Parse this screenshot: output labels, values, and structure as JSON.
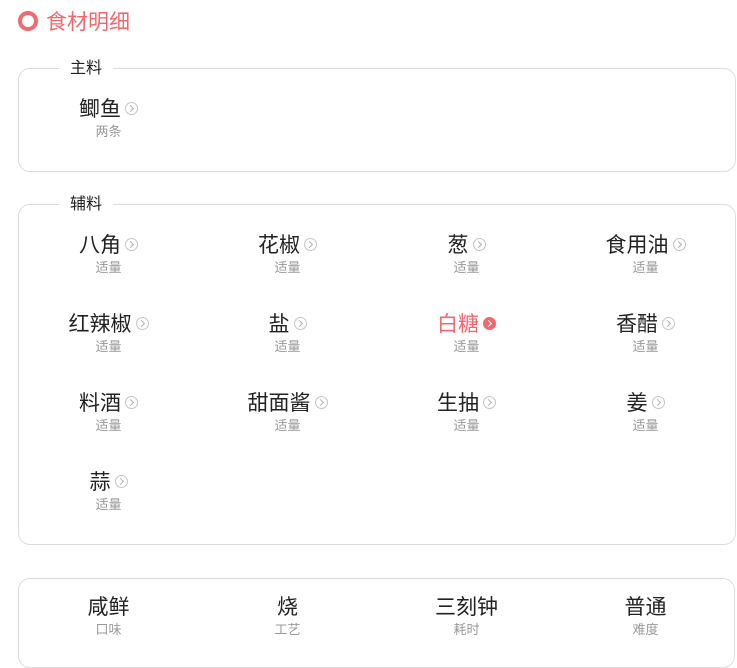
{
  "section_title": "食材明细",
  "main": {
    "legend": "主料",
    "items": [
      {
        "name": "鲫鱼",
        "qty": "两条"
      }
    ]
  },
  "aux": {
    "legend": "辅料",
    "items": [
      {
        "name": "八角",
        "qty": "适量"
      },
      {
        "name": "花椒",
        "qty": "适量"
      },
      {
        "name": "葱",
        "qty": "适量"
      },
      {
        "name": "食用油",
        "qty": "适量"
      },
      {
        "name": "红辣椒",
        "qty": "适量"
      },
      {
        "name": "盐",
        "qty": "适量"
      },
      {
        "name": "白糖",
        "qty": "适量",
        "highlight": true
      },
      {
        "name": "香醋",
        "qty": "适量"
      },
      {
        "name": "料酒",
        "qty": "适量"
      },
      {
        "name": "甜面酱",
        "qty": "适量"
      },
      {
        "name": "生抽",
        "qty": "适量"
      },
      {
        "name": "姜",
        "qty": "适量"
      },
      {
        "name": "蒜",
        "qty": "适量"
      }
    ]
  },
  "summary": [
    {
      "value": "咸鲜",
      "label": "口味"
    },
    {
      "value": "烧",
      "label": "工艺"
    },
    {
      "value": "三刻钟",
      "label": "耗时"
    },
    {
      "value": "普通",
      "label": "难度"
    }
  ],
  "colors": {
    "accent": "#f0696e",
    "border": "#dcdcdc"
  }
}
